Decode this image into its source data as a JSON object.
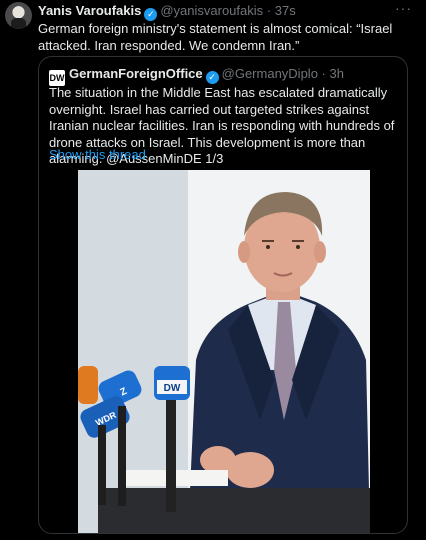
{
  "tweet": {
    "author_name": "Yanis Varoufakis",
    "verified_mark": "✓",
    "handle": "@yanisvaroufakis",
    "separator": "·",
    "time": "37s",
    "more": "···",
    "text": "German foreign ministry's statement is almost comical: “Israel attacked. Iran responded. We condemn Iran.”"
  },
  "quote": {
    "logo_text": "DW",
    "author_name": "GermanForeignOffice",
    "verified_mark": "✓",
    "handle": "@GermanyDiplo",
    "separator": "·",
    "time": "3h",
    "text": "The situation in the Middle East has escalated dramatically overnight. Israel has carried out targeted strikes against Iranian nuclear facilities. Iran is responding with hundreds of drone attacks on Israel. This development is more than alarming. @AussenMinDE 1/3",
    "show_thread": "Show this thread",
    "photo": {
      "mic_labels": [
        "DW",
        "Z",
        "WDR"
      ]
    }
  },
  "colors": {
    "background": "#000000",
    "text": "#e7e9ea",
    "muted": "#71767b",
    "link": "#1d9bf0",
    "border": "#2f3336"
  }
}
